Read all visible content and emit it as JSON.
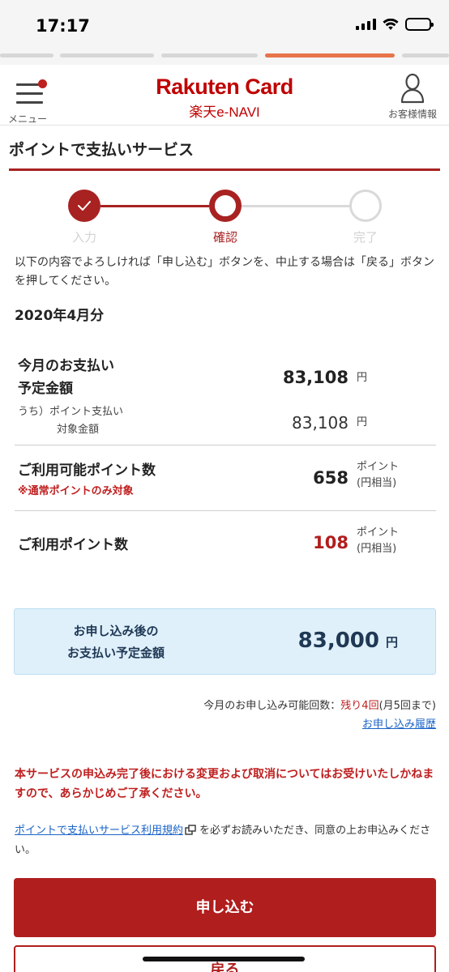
{
  "status_bar": {
    "time": "17:17"
  },
  "header": {
    "menu_label": "メニュー",
    "logo_main": "Rakuten Card",
    "logo_sub": "楽天e-NAVI",
    "account_label": "お客様情報"
  },
  "page": {
    "title": "ポイントで支払いサービス",
    "steps": [
      {
        "label": "入力",
        "state": "done"
      },
      {
        "label": "確認",
        "state": "current"
      },
      {
        "label": "完了",
        "state": "upcoming"
      }
    ],
    "intro": "以下の内容でよろしければ「申し込む」ボタンを、中止する場合は「戻る」ボタンを押してください。",
    "month": "2020年4月分"
  },
  "summary": {
    "payment_label_1": "今月のお支払い",
    "payment_label_2": "予定金額",
    "payment_amount": "83,108",
    "payment_unit": "円",
    "target_label_1": "うち）ポイント支払い",
    "target_label_2": "対象金額",
    "target_amount": "83,108",
    "target_unit": "円",
    "available_label": "ご利用可能ポイント数",
    "available_note": "※通常ポイントのみ対象",
    "available_value": "658",
    "points_unit_1": "ポイント",
    "points_unit_2": "(円相当)",
    "use_label": "ご利用ポイント数",
    "use_value": "108"
  },
  "result": {
    "label_1": "お申し込み後の",
    "label_2": "お支払い予定金額",
    "amount": "83,000",
    "unit": "円"
  },
  "application": {
    "remaining_prefix": "今月のお申し込み可能回数：",
    "remaining_highlight": "残り4回",
    "remaining_suffix": "(月5回まで)",
    "history_link": "お申し込み履歴"
  },
  "notice": {
    "warning": "本サービスの申込み完了後における変更および取消についてはお受けいたしかねますので、あらかじめご了承ください。",
    "terms_link": "ポイントで支払いサービス利用規約",
    "terms_suffix": "を必ずお読みいただき、同意の上お申込みください。"
  },
  "buttons": {
    "apply": "申し込む",
    "back": "戻る"
  },
  "colors": {
    "brand_red": "#bf0000",
    "accent_red": "#b01e1e",
    "link_blue": "#1a63c7",
    "result_bg": "#dff0fb",
    "progress_orange": "#e8744a"
  }
}
